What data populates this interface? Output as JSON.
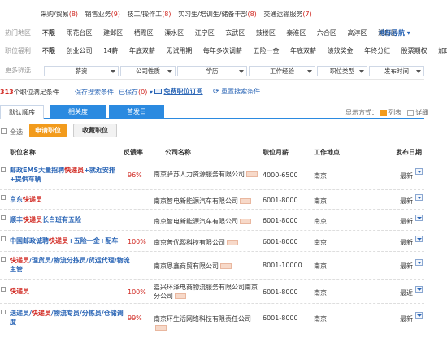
{
  "categories": [
    {
      "label": "采购/贸易",
      "count": "(8)"
    },
    {
      "label": "销售业务",
      "count": "(9)"
    },
    {
      "label": "技工/操作工",
      "count": "(8)"
    },
    {
      "label": "实习生/培训生/储备干部",
      "count": "(8)"
    },
    {
      "label": "交通运输服务",
      "count": "(7)"
    }
  ],
  "hot_area": {
    "label": "热门地区",
    "options": [
      "不限",
      "雨花台区",
      "建邺区",
      "栖霞区",
      "溧水区",
      "江宁区",
      "玄武区",
      "鼓楼区",
      "秦淮区",
      "六合区",
      "高淳区",
      "浦口区"
    ],
    "map_link": "地标导航"
  },
  "benefits": {
    "label": "职位福利",
    "options": [
      "不限",
      "创业公司",
      "14薪",
      "年底双薪",
      "无试用期",
      "每年多次调薪",
      "五险一金",
      "年底双薪",
      "绩效奖金",
      "年终分红",
      "股票期权",
      "加班补助"
    ]
  },
  "more_filter": {
    "label": "更多筛选",
    "selects": [
      "薪资",
      "公司性质",
      "学历",
      "工作经验",
      "职位类型",
      "发布时间"
    ]
  },
  "toolbar": {
    "count_num": "313",
    "count_text": "个职位满足条件",
    "save_cond": "保存搜索条件",
    "saved_cond": "已保存",
    "saved_count": "(0)",
    "subscribe": "免费职位订阅",
    "reset": "重置搜索条件"
  },
  "tabs": [
    "默认顺序",
    "相关度",
    "首发日"
  ],
  "view": {
    "label": "显示方式：",
    "list": "列表",
    "detail": "详细"
  },
  "actions": {
    "select_all": "全选",
    "apply": "申请职位",
    "collect": "收藏职位"
  },
  "table": {
    "headers": [
      "职位名称",
      "反馈率",
      "公司名称",
      "职位月薪",
      "工作地点",
      "发布日期"
    ],
    "rows": [
      {
        "title_pre": "邮政EMS大量招聘",
        "title_hl": "快递员",
        "title_post": "+就近安排+提供车辆",
        "rate": "96%",
        "company": "南京驿苏人力资源服务有限公司",
        "salary": "4000-6500",
        "city": "南京",
        "date": "最新"
      },
      {
        "title_pre": "京东",
        "title_hl": "快递员",
        "title_post": "",
        "rate": "",
        "company": "南京智电新能源汽车有限公司",
        "salary": "6001-8000",
        "city": "南京",
        "date": "最新"
      },
      {
        "title_pre": "顺丰",
        "title_hl": "快递员",
        "title_post": "长白班有五险",
        "rate": "",
        "company": "南京智电新能源汽车有限公司",
        "salary": "6001-8000",
        "city": "南京",
        "date": "最新"
      },
      {
        "title_pre": "中国邮政诚聘",
        "title_hl": "快递员",
        "title_post": "+五险一金+配车",
        "rate": "100%",
        "company": "南京普优熙科技有限公司",
        "salary": "6001-8000",
        "city": "南京",
        "date": "最新"
      },
      {
        "title_pre": "",
        "title_hl": "快递员",
        "title_post": "/理货员/物流分拣员/货运代理/物流主管",
        "rate": "",
        "company": "南京恩鑫商贸有限公司",
        "salary": "8001-10000",
        "city": "南京",
        "date": "最新"
      },
      {
        "title_pre": "",
        "title_hl": "快递员",
        "title_post": "",
        "rate": "100%",
        "company": "嘉兴环泽电商物流服务有限公司南京分公司",
        "salary": "6001-8000",
        "city": "南京",
        "date": "最近"
      },
      {
        "title_pre": "送递员/",
        "title_hl": "快递员",
        "title_post": "/物流专员/分拣员/仓储调度",
        "rate": "99%",
        "company": "南京环生活网络科技有限责任公司",
        "salary": "6001-8000",
        "city": "南京",
        "date": "最新"
      }
    ]
  }
}
